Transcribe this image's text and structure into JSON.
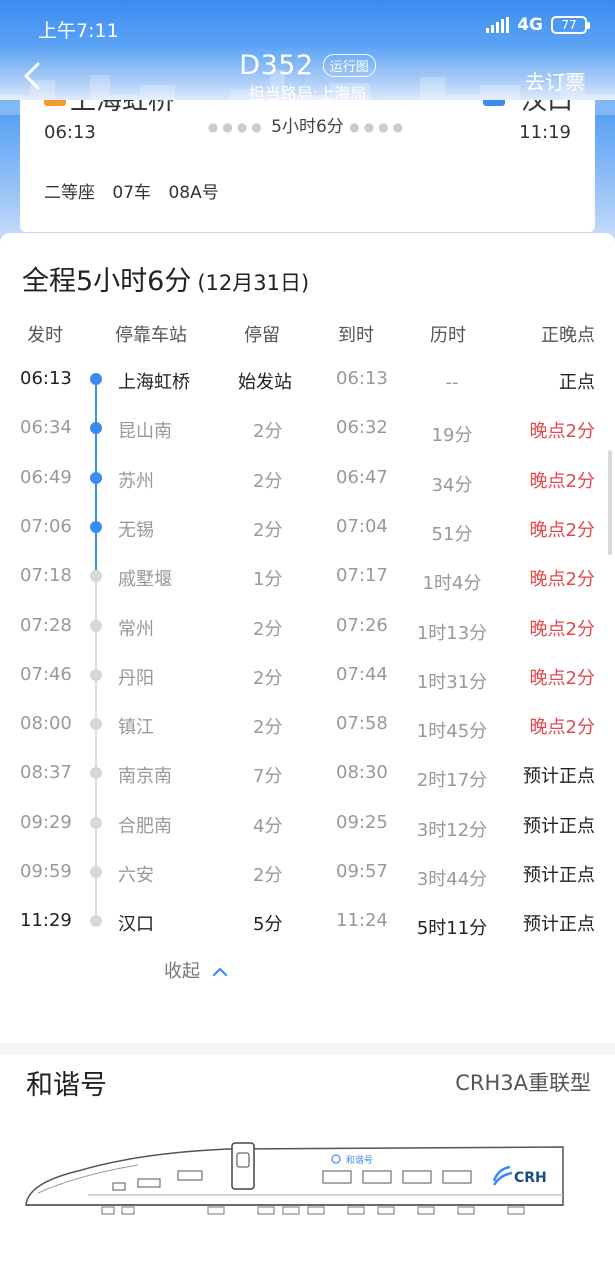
{
  "status_bar": {
    "time": "上午7:11",
    "network": "4G",
    "battery": "77"
  },
  "nav": {
    "train_no": "D352",
    "route_map": "运行图",
    "bureau": "担当路局:上海局",
    "order": "去订票"
  },
  "ticket": {
    "from_station": "上海虹桥",
    "to_station": "汉口",
    "dep_time": "06:13",
    "arr_time": "11:19",
    "duration": "5小时6分",
    "seat_class": "二等座",
    "car": "07车",
    "seat": "08A号"
  },
  "schedule": {
    "title": "全程5小时6分",
    "date": "(12月31日)",
    "headers": {
      "dep": "发时",
      "station": "停靠车站",
      "stop": "停留",
      "arr": "到时",
      "elapsed": "历时",
      "punctuality": "正晚点"
    },
    "stops": [
      {
        "dep": "06:13",
        "station": "上海虹桥",
        "stop": "始发站",
        "arr": "06:13",
        "elapsed": "--",
        "status": "正点"
      },
      {
        "dep": "06:34",
        "station": "昆山南",
        "stop": "2分",
        "arr": "06:32",
        "elapsed": "19分",
        "status": "晚点2分"
      },
      {
        "dep": "06:49",
        "station": "苏州",
        "stop": "2分",
        "arr": "06:47",
        "elapsed": "34分",
        "status": "晚点2分"
      },
      {
        "dep": "07:06",
        "station": "无锡",
        "stop": "2分",
        "arr": "07:04",
        "elapsed": "51分",
        "status": "晚点2分"
      },
      {
        "dep": "07:18",
        "station": "戚墅堰",
        "stop": "1分",
        "arr": "07:17",
        "elapsed": "1时4分",
        "status": "晚点2分"
      },
      {
        "dep": "07:28",
        "station": "常州",
        "stop": "2分",
        "arr": "07:26",
        "elapsed": "1时13分",
        "status": "晚点2分"
      },
      {
        "dep": "07:46",
        "station": "丹阳",
        "stop": "2分",
        "arr": "07:44",
        "elapsed": "1时31分",
        "status": "晚点2分"
      },
      {
        "dep": "08:00",
        "station": "镇江",
        "stop": "2分",
        "arr": "07:58",
        "elapsed": "1时45分",
        "status": "晚点2分"
      },
      {
        "dep": "08:37",
        "station": "南京南",
        "stop": "7分",
        "arr": "08:30",
        "elapsed": "2时17分",
        "status": "预计正点"
      },
      {
        "dep": "09:29",
        "station": "合肥南",
        "stop": "4分",
        "arr": "09:25",
        "elapsed": "3时12分",
        "status": "预计正点"
      },
      {
        "dep": "09:59",
        "station": "六安",
        "stop": "2分",
        "arr": "09:57",
        "elapsed": "3时44分",
        "status": "预计正点"
      },
      {
        "dep": "11:29",
        "station": "汉口",
        "stop": "5分",
        "arr": "11:24",
        "elapsed": "5时11分",
        "status": "预计正点"
      }
    ],
    "collapse": "收起"
  },
  "train_model": {
    "name": "和谐号",
    "type": "CRH3A重联型",
    "livery_text": "和谐号",
    "logo_text": "CRH"
  },
  "colors": {
    "primary": "#3a8cf0",
    "late": "#e5474a",
    "origin_mark": "#f59a2e"
  }
}
